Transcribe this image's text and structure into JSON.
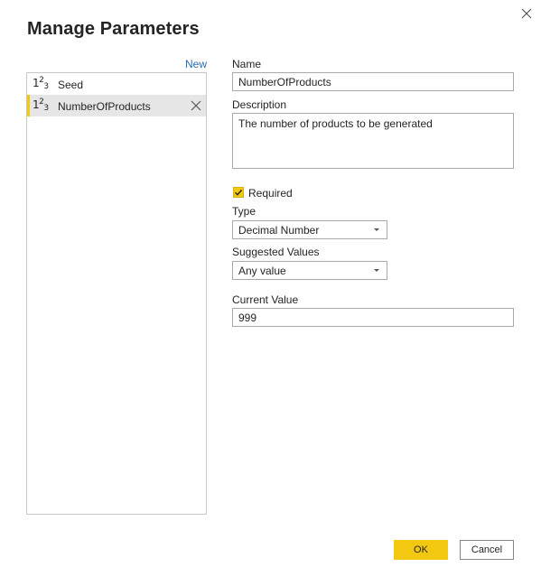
{
  "dialog": {
    "title": "Manage Parameters",
    "close_icon": "close-icon"
  },
  "list": {
    "new_label": "New",
    "items": [
      {
        "icon": "123-number-type-icon",
        "label": "Seed",
        "selected": false
      },
      {
        "icon": "123-number-type-icon",
        "label": "NumberOfProducts",
        "selected": true
      }
    ]
  },
  "form": {
    "name_label": "Name",
    "name_value": "NumberOfProducts",
    "description_label": "Description",
    "description_value": "The number of products to be generated",
    "required_label": "Required",
    "required_checked": true,
    "type_label": "Type",
    "type_value": "Decimal Number",
    "suggested_label": "Suggested Values",
    "suggested_value": "Any value",
    "current_label": "Current Value",
    "current_value": "999"
  },
  "footer": {
    "ok_label": "OK",
    "cancel_label": "Cancel"
  },
  "colors": {
    "accent": "#f2c811",
    "link": "#2b6cb0",
    "selected_row": "#e6e6e6"
  }
}
